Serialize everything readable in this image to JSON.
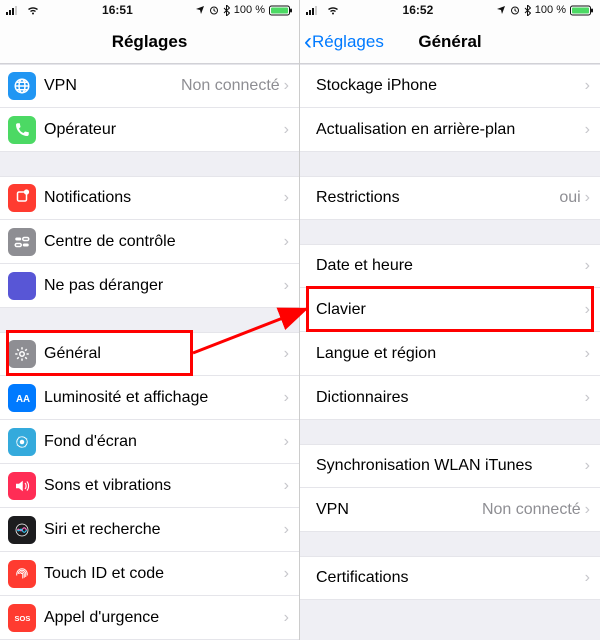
{
  "left": {
    "statusbar": {
      "time": "16:51",
      "battery": "100 %"
    },
    "nav": {
      "title": "Réglages"
    },
    "groups": [
      [
        {
          "icon": "globe-icon",
          "iconClass": "bg-blue-globe",
          "label": "VPN",
          "value": "Non connecté"
        },
        {
          "icon": "phone-icon",
          "iconClass": "bg-green-phone",
          "label": "Opérateur",
          "value": ""
        }
      ],
      [
        {
          "icon": "notifications-icon",
          "iconClass": "bg-red-notif",
          "label": "Notifications"
        },
        {
          "icon": "control-center-icon",
          "iconClass": "bg-grey-control",
          "label": "Centre de contrôle"
        },
        {
          "icon": "moon-icon",
          "iconClass": "bg-purple-moon",
          "label": "Ne pas déranger"
        }
      ],
      [
        {
          "icon": "gear-icon",
          "iconClass": "bg-grey-general",
          "label": "Général",
          "highlight": true
        },
        {
          "icon": "display-icon",
          "iconClass": "bg-blue-display",
          "label": "Luminosité et affichage"
        },
        {
          "icon": "wallpaper-icon",
          "iconClass": "bg-cyan-wall",
          "label": "Fond d'écran"
        },
        {
          "icon": "sound-icon",
          "iconClass": "bg-red-sound",
          "label": "Sons et vibrations"
        },
        {
          "icon": "siri-icon",
          "iconClass": "bg-black-siri",
          "label": "Siri et recherche"
        },
        {
          "icon": "fingerprint-icon",
          "iconClass": "bg-red-touch",
          "label": "Touch ID et code"
        },
        {
          "icon": "sos-icon",
          "iconClass": "bg-red-sos",
          "label": "Appel d'urgence"
        }
      ]
    ]
  },
  "right": {
    "statusbar": {
      "time": "16:52",
      "battery": "100 %"
    },
    "nav": {
      "back": "Réglages",
      "title": "Général"
    },
    "groups": [
      [
        {
          "label": "Stockage iPhone"
        },
        {
          "label": "Actualisation en arrière-plan"
        }
      ],
      [
        {
          "label": "Restrictions",
          "value": "oui"
        }
      ],
      [
        {
          "label": "Date et heure"
        },
        {
          "label": "Clavier",
          "highlight": true
        },
        {
          "label": "Langue et région"
        },
        {
          "label": "Dictionnaires"
        }
      ],
      [
        {
          "label": "Synchronisation WLAN iTunes"
        },
        {
          "label": "VPN",
          "value": "Non connecté"
        }
      ],
      [
        {
          "label": "Certifications"
        }
      ]
    ]
  },
  "colors": {
    "highlight": "#ff0000"
  }
}
